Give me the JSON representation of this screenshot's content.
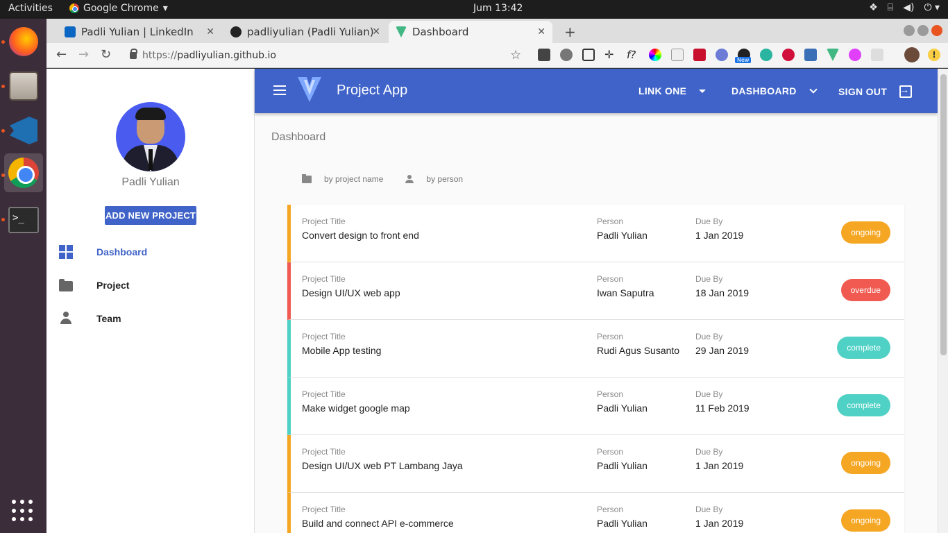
{
  "system": {
    "activities": "Activities",
    "app_name": "Google Chrome",
    "clock": "Jum 13:42"
  },
  "browser": {
    "tabs": [
      {
        "title": "Padli Yulian | LinkedIn"
      },
      {
        "title": "padliyulian (Padli Yulian)"
      },
      {
        "title": "Dashboard",
        "active": true
      }
    ],
    "url_prefix": "https://",
    "url_host": "padliyulian.github.io",
    "new_badge": "New"
  },
  "drawer": {
    "user_name": "Padli Yulian",
    "add_button": "ADD NEW PROJECT",
    "nav": [
      {
        "label": "Dashboard",
        "icon": "dashboard-icon",
        "active": true
      },
      {
        "label": "Project",
        "icon": "folder-icon"
      },
      {
        "label": "Team",
        "icon": "person-icon"
      }
    ]
  },
  "appbar": {
    "title": "Project App",
    "link_one": "LINK ONE",
    "dashboard": "DASHBOARD",
    "sign_out": "SIGN OUT"
  },
  "page": {
    "breadcrumb": "Dashboard",
    "sort_by_project": "by project name",
    "sort_by_person": "by person",
    "labels": {
      "title": "Project Title",
      "person": "Person",
      "due": "Due By"
    }
  },
  "projects": [
    {
      "title": "Convert design to front end",
      "person": "Padli Yulian",
      "due": "1 Jan 2019",
      "status": "ongoing"
    },
    {
      "title": "Design UI/UX web app",
      "person": "Iwan Saputra",
      "due": "18 Jan 2019",
      "status": "overdue"
    },
    {
      "title": "Mobile App testing",
      "person": "Rudi Agus Susanto",
      "due": "29 Jan 2019",
      "status": "complete"
    },
    {
      "title": "Make widget google map",
      "person": "Padli Yulian",
      "due": "11 Feb 2019",
      "status": "complete"
    },
    {
      "title": "Design UI/UX web PT Lambang Jaya",
      "person": "Padli Yulian",
      "due": "1 Jan 2019",
      "status": "ongoing"
    },
    {
      "title": "Build and connect API e-commerce",
      "person": "Padli Yulian",
      "due": "1 Jan 2019",
      "status": "ongoing"
    }
  ],
  "colors": {
    "primary": "#3f63c8",
    "ongoing": "#f5a623",
    "overdue": "#f05a50",
    "complete": "#4fd1c5"
  }
}
